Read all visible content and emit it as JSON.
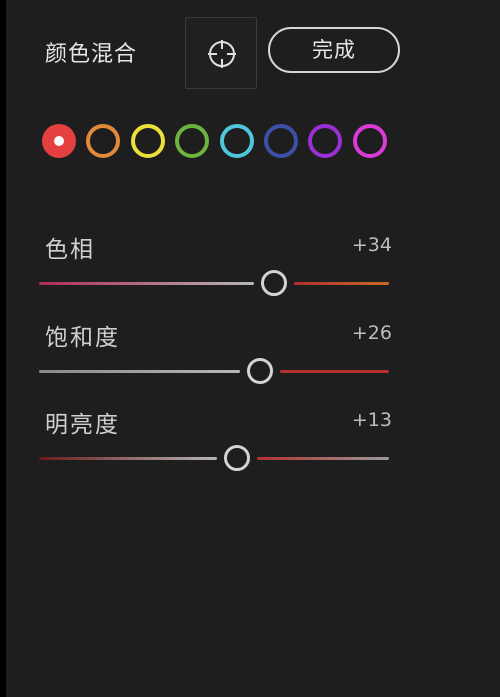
{
  "header": {
    "title": "颜色混合",
    "done_label": "完成"
  },
  "swatches": [
    {
      "name": "red",
      "color": "#e44040",
      "selected": true
    },
    {
      "name": "orange",
      "color": "#e08a3a",
      "selected": false
    },
    {
      "name": "yellow",
      "color": "#ece03a",
      "selected": false
    },
    {
      "name": "green",
      "color": "#6fb33f",
      "selected": false
    },
    {
      "name": "aqua",
      "color": "#4fc6dc",
      "selected": false
    },
    {
      "name": "blue",
      "color": "#3e4fa8",
      "selected": false
    },
    {
      "name": "purple",
      "color": "#9a2fd6",
      "selected": false
    },
    {
      "name": "magenta",
      "color": "#dc3ad6",
      "selected": false
    }
  ],
  "sliders": [
    {
      "label": "色相",
      "value": "+34",
      "level": 34,
      "left_color": "#b02a5a",
      "right_color": "#c56a26"
    },
    {
      "label": "饱和度",
      "value": "+26",
      "level": 26,
      "left_color": "#8a8a8a",
      "right_color": "#b8302c"
    },
    {
      "label": "明亮度",
      "value": "+13",
      "level": 13,
      "left_color": "#6a1a1a",
      "right_color": "#9a9a9a"
    }
  ]
}
